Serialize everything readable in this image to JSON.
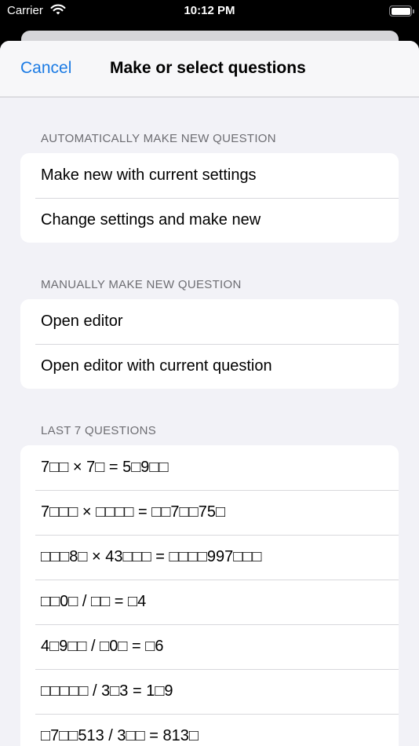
{
  "status_bar": {
    "carrier": "Carrier",
    "time": "10:12 PM"
  },
  "nav": {
    "cancel_label": "Cancel",
    "title": "Make or select questions"
  },
  "sections": {
    "auto": {
      "header": "AUTOMATICALLY MAKE NEW QUESTION",
      "items": [
        "Make new with current settings",
        "Change settings and make new"
      ]
    },
    "manual": {
      "header": "MANUALLY MAKE NEW QUESTION",
      "items": [
        "Open editor",
        "Open editor with current question"
      ]
    },
    "last": {
      "header": "LAST 7 QUESTIONS",
      "items": [
        "7□□ × 7□ = 5□9□□",
        "7□□□ × □□□□ = □□7□□75□",
        "□□□8□ × 43□□□ = □□□□997□□□",
        "□□0□ / □□ = □4",
        "4□9□□ / □0□ = □6",
        "□□□□□ / 3□3 = 1□9",
        "□7□□513 / 3□□ = 813□"
      ]
    }
  },
  "colors": {
    "accent": "#1b7be4",
    "background": "#f2f2f7"
  },
  "icons": [
    "wifi-icon",
    "battery-icon"
  ]
}
